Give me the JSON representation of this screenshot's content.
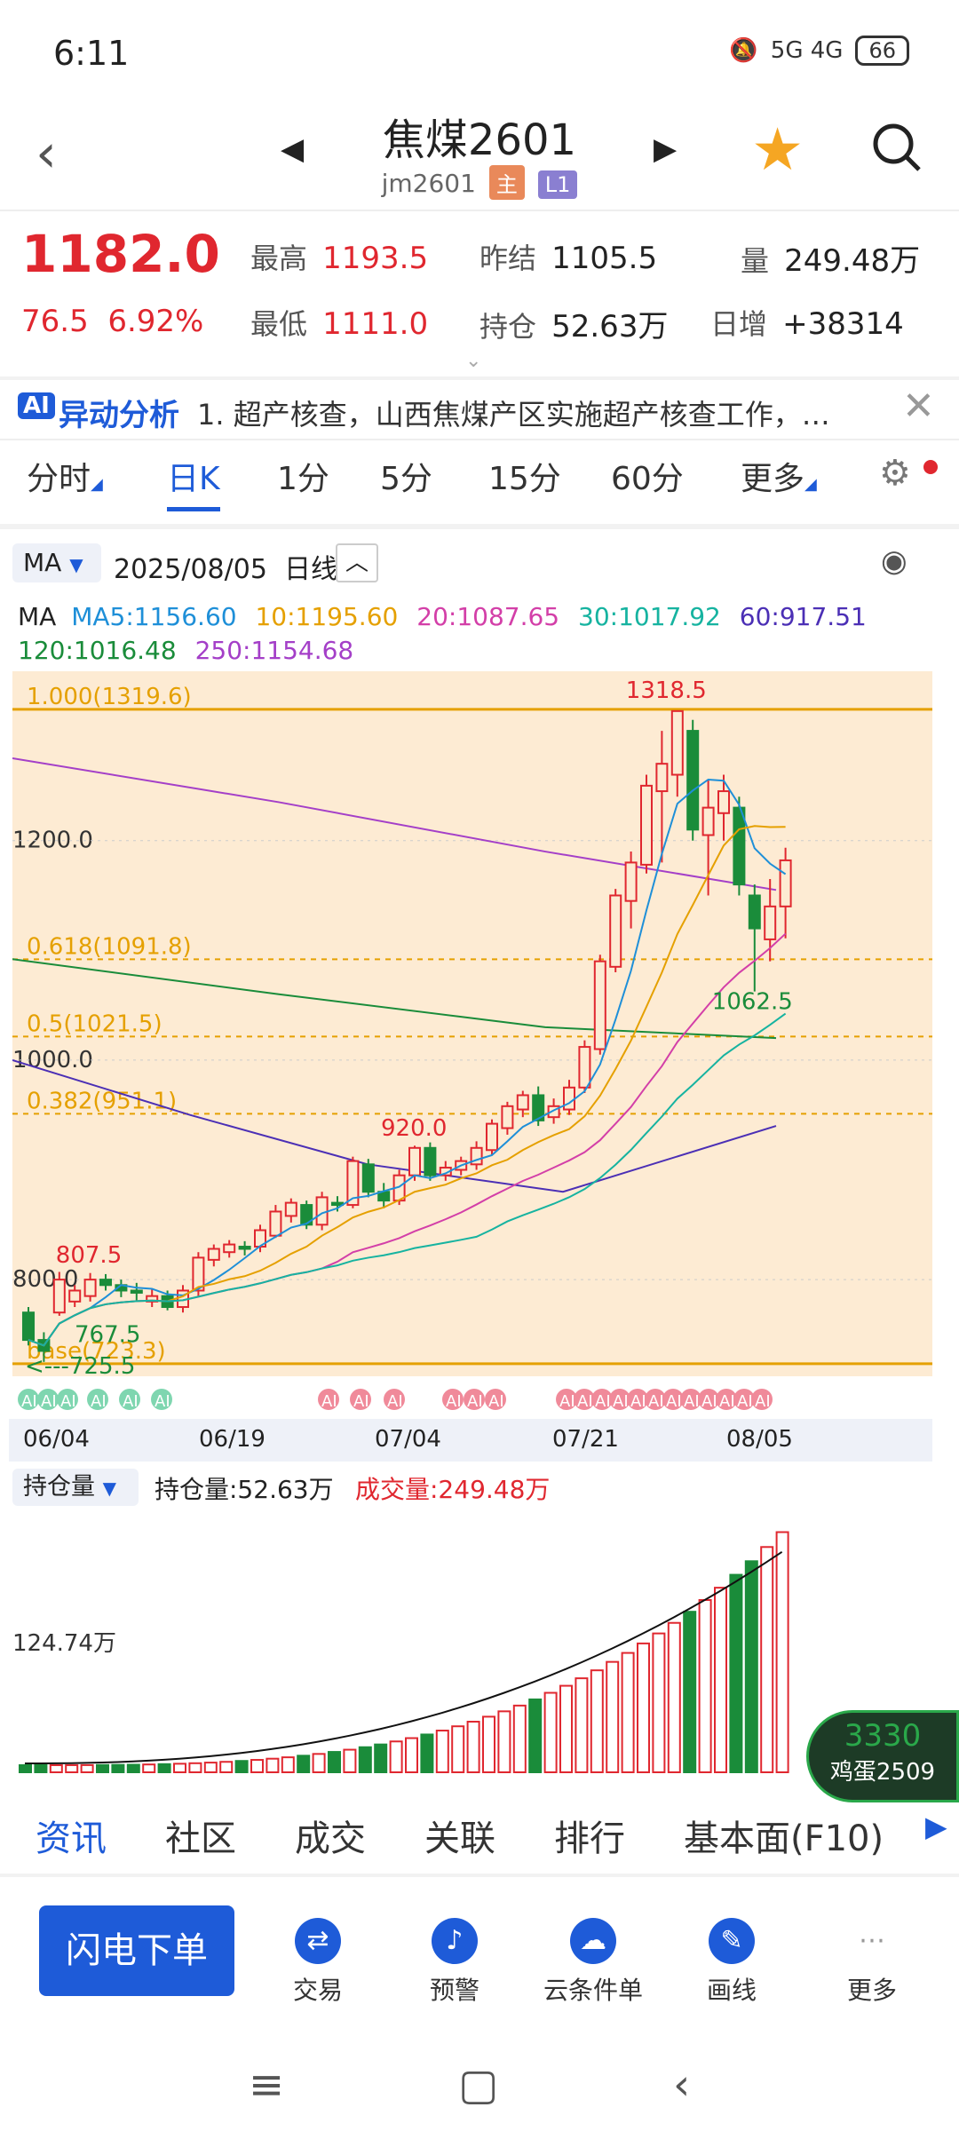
{
  "status": {
    "time": "6:11",
    "network": "5G 4G",
    "battery": "66"
  },
  "header": {
    "title": "焦煤2601",
    "code": "jm2601",
    "tag_main": "主",
    "tag_l1": "L1"
  },
  "quote": {
    "price": "1182.0",
    "change": "76.5",
    "change_pct": "6.92%",
    "high_label": "最高",
    "high": "1193.5",
    "low_label": "最低",
    "low": "1111.0",
    "prev_settle_label": "昨结",
    "prev_settle": "1105.5",
    "open_interest_label": "持仓",
    "open_interest": "52.63万",
    "volume_label": "量",
    "volume": "249.48万",
    "daily_inc_label": "日增",
    "daily_inc": "+38314"
  },
  "ai_bar": {
    "label": "异动分析",
    "text": "1. 超产核查，山西焦煤产区实施超产核查工作，…"
  },
  "period_tabs": [
    "分时",
    "日K",
    "1分",
    "5分",
    "15分",
    "60分",
    "更多"
  ],
  "chart_header": {
    "indicator": "MA",
    "date": "2025/08/05",
    "period": "日线"
  },
  "ma_line1": [
    {
      "text": "MA",
      "color": "#222222"
    },
    {
      "text": "MA5:1156.60",
      "color": "#1e8fd8"
    },
    {
      "text": "10:1195.60",
      "color": "#e5a000"
    },
    {
      "text": "20:1087.65",
      "color": "#d33fa8"
    },
    {
      "text": "30:1017.92",
      "color": "#16b3a0"
    },
    {
      "text": "60:917.51",
      "color": "#4b2fb5"
    }
  ],
  "ma_line2": [
    {
      "text": "120:1016.48",
      "color": "#1a8c3a"
    },
    {
      "text": "250:1154.68",
      "color": "#a43fc8"
    }
  ],
  "chart_labels": {
    "fib_1": "1.000(1319.6)",
    "fib_0618": "0.618(1091.8)",
    "fib_05": "0.5(1021.5)",
    "fib_0382": "0.382(951.1)",
    "fib_base": "base(723.3)",
    "y_1200": "1200.0",
    "y_1000": "1000.0",
    "y_800": "800.0",
    "peak": "1318.5",
    "low_recent": "1062.5",
    "mark_920": "920.0",
    "mark_807": "807.5",
    "mark_767": "767.5",
    "mark_725": "<---725.5"
  },
  "x_dates": [
    "06/04",
    "06/19",
    "07/04",
    "07/21",
    "08/05"
  ],
  "volume_header": {
    "selector": "持仓量",
    "oi": "持仓量:52.63万",
    "vol": "成交量:249.48万",
    "axis": "124.74万"
  },
  "floating": {
    "price": "3330",
    "name": "鸡蛋2509"
  },
  "bottom_tabs": [
    "资讯",
    "社区",
    "成交",
    "关联",
    "排行",
    "基本面(F10)"
  ],
  "actions": {
    "flash_order": "闪电下单",
    "trade": "交易",
    "alert": "预警",
    "cloud": "云条件单",
    "draw": "画线",
    "more": "更多"
  },
  "chart_data": {
    "type": "candlestick",
    "x_dates_visible": [
      "06/04",
      "06/19",
      "07/04",
      "07/21",
      "08/05"
    ],
    "ylim": [
      720,
      1330
    ],
    "y_ticks": [
      800.0,
      1000.0,
      1200.0
    ],
    "fibonacci": [
      {
        "label": "1.000",
        "value": 1319.6
      },
      {
        "label": "0.618",
        "value": 1091.8
      },
      {
        "label": "0.5",
        "value": 1021.5
      },
      {
        "label": "0.382",
        "value": 951.1
      },
      {
        "label": "base",
        "value": 723.3
      }
    ],
    "candles": [
      {
        "o": 770,
        "c": 745,
        "h": 775,
        "l": 740
      },
      {
        "o": 745,
        "c": 735,
        "h": 752,
        "l": 725
      },
      {
        "o": 770,
        "c": 800,
        "h": 807,
        "l": 767
      },
      {
        "o": 780,
        "c": 790,
        "h": 795,
        "l": 775
      },
      {
        "o": 785,
        "c": 800,
        "h": 806,
        "l": 780
      },
      {
        "o": 800,
        "c": 795,
        "h": 805,
        "l": 790
      },
      {
        "o": 795,
        "c": 790,
        "h": 800,
        "l": 784
      },
      {
        "o": 790,
        "c": 788,
        "h": 797,
        "l": 780
      },
      {
        "o": 780,
        "c": 785,
        "h": 792,
        "l": 775
      },
      {
        "o": 785,
        "c": 775,
        "h": 790,
        "l": 772
      },
      {
        "o": 775,
        "c": 790,
        "h": 795,
        "l": 770
      },
      {
        "o": 790,
        "c": 820,
        "h": 825,
        "l": 785
      },
      {
        "o": 818,
        "c": 828,
        "h": 832,
        "l": 812
      },
      {
        "o": 825,
        "c": 832,
        "h": 836,
        "l": 820
      },
      {
        "o": 830,
        "c": 828,
        "h": 835,
        "l": 822
      },
      {
        "o": 830,
        "c": 845,
        "h": 850,
        "l": 825
      },
      {
        "o": 840,
        "c": 862,
        "h": 868,
        "l": 838
      },
      {
        "o": 858,
        "c": 870,
        "h": 874,
        "l": 852
      },
      {
        "o": 868,
        "c": 850,
        "h": 872,
        "l": 846
      },
      {
        "o": 850,
        "c": 875,
        "h": 880,
        "l": 845
      },
      {
        "o": 870,
        "c": 868,
        "h": 876,
        "l": 862
      },
      {
        "o": 868,
        "c": 908,
        "h": 912,
        "l": 865
      },
      {
        "o": 905,
        "c": 880,
        "h": 910,
        "l": 875
      },
      {
        "o": 880,
        "c": 872,
        "h": 888,
        "l": 865
      },
      {
        "o": 872,
        "c": 895,
        "h": 900,
        "l": 868
      },
      {
        "o": 895,
        "c": 920,
        "h": 922,
        "l": 890
      },
      {
        "o": 920,
        "c": 895,
        "h": 925,
        "l": 890
      },
      {
        "o": 895,
        "c": 902,
        "h": 908,
        "l": 890
      },
      {
        "o": 900,
        "c": 908,
        "h": 912,
        "l": 895
      },
      {
        "o": 905,
        "c": 920,
        "h": 926,
        "l": 900
      },
      {
        "o": 918,
        "c": 942,
        "h": 946,
        "l": 914
      },
      {
        "o": 938,
        "c": 958,
        "h": 962,
        "l": 932
      },
      {
        "o": 955,
        "c": 968,
        "h": 972,
        "l": 948
      },
      {
        "o": 968,
        "c": 945,
        "h": 976,
        "l": 940
      },
      {
        "o": 948,
        "c": 958,
        "h": 965,
        "l": 942
      },
      {
        "o": 955,
        "c": 975,
        "h": 982,
        "l": 950
      },
      {
        "o": 975,
        "c": 1012,
        "h": 1018,
        "l": 970
      },
      {
        "o": 1010,
        "c": 1090,
        "h": 1096,
        "l": 1005
      },
      {
        "o": 1085,
        "c": 1150,
        "h": 1156,
        "l": 1080
      },
      {
        "o": 1145,
        "c": 1180,
        "h": 1190,
        "l": 1120
      },
      {
        "o": 1178,
        "c": 1250,
        "h": 1260,
        "l": 1170
      },
      {
        "o": 1245,
        "c": 1270,
        "h": 1300,
        "l": 1180
      },
      {
        "o": 1260,
        "c": 1318,
        "h": 1318.5,
        "l": 1240
      },
      {
        "o": 1300,
        "c": 1210,
        "h": 1310,
        "l": 1200
      },
      {
        "o": 1205,
        "c": 1230,
        "h": 1255,
        "l": 1150
      },
      {
        "o": 1225,
        "c": 1245,
        "h": 1260,
        "l": 1200
      },
      {
        "o": 1230,
        "c": 1160,
        "h": 1240,
        "l": 1150
      },
      {
        "o": 1150,
        "c": 1120,
        "h": 1160,
        "l": 1062.5
      },
      {
        "o": 1110,
        "c": 1140,
        "h": 1165,
        "l": 1090
      },
      {
        "o": 1140,
        "c": 1182,
        "h": 1193.5,
        "l": 1111
      }
    ]
  }
}
